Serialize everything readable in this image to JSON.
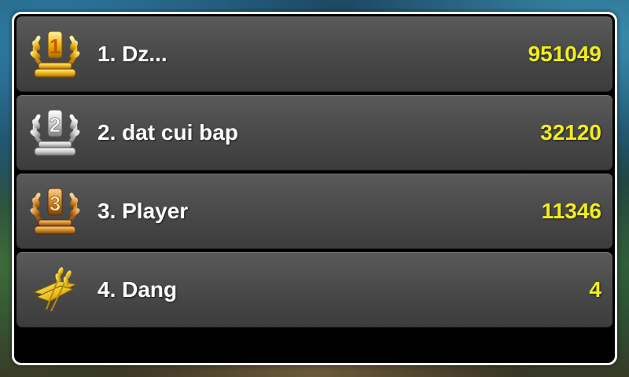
{
  "leaderboard": {
    "rows": [
      {
        "name": "1. Dz...",
        "score": "951049",
        "medal": "gold-trophy-icon",
        "medal_numeral": "1"
      },
      {
        "name": "2. dat cui bap",
        "score": "32120",
        "medal": "silver-trophy-icon",
        "medal_numeral": "2"
      },
      {
        "name": "3. Player",
        "score": "11346",
        "medal": "bronze-trophy-icon",
        "medal_numeral": "3"
      },
      {
        "name": "4. Dang",
        "score": "4",
        "medal": "golden-wheat-emblem-icon"
      }
    ]
  },
  "colors": {
    "score": "#f2ee1a",
    "name": "#ffffff",
    "row_bg": "#4b4b4b",
    "frame": "#ffffff",
    "gold": "#f0b417",
    "silver": "#d8d8d8",
    "bronze": "#d08a2a"
  }
}
